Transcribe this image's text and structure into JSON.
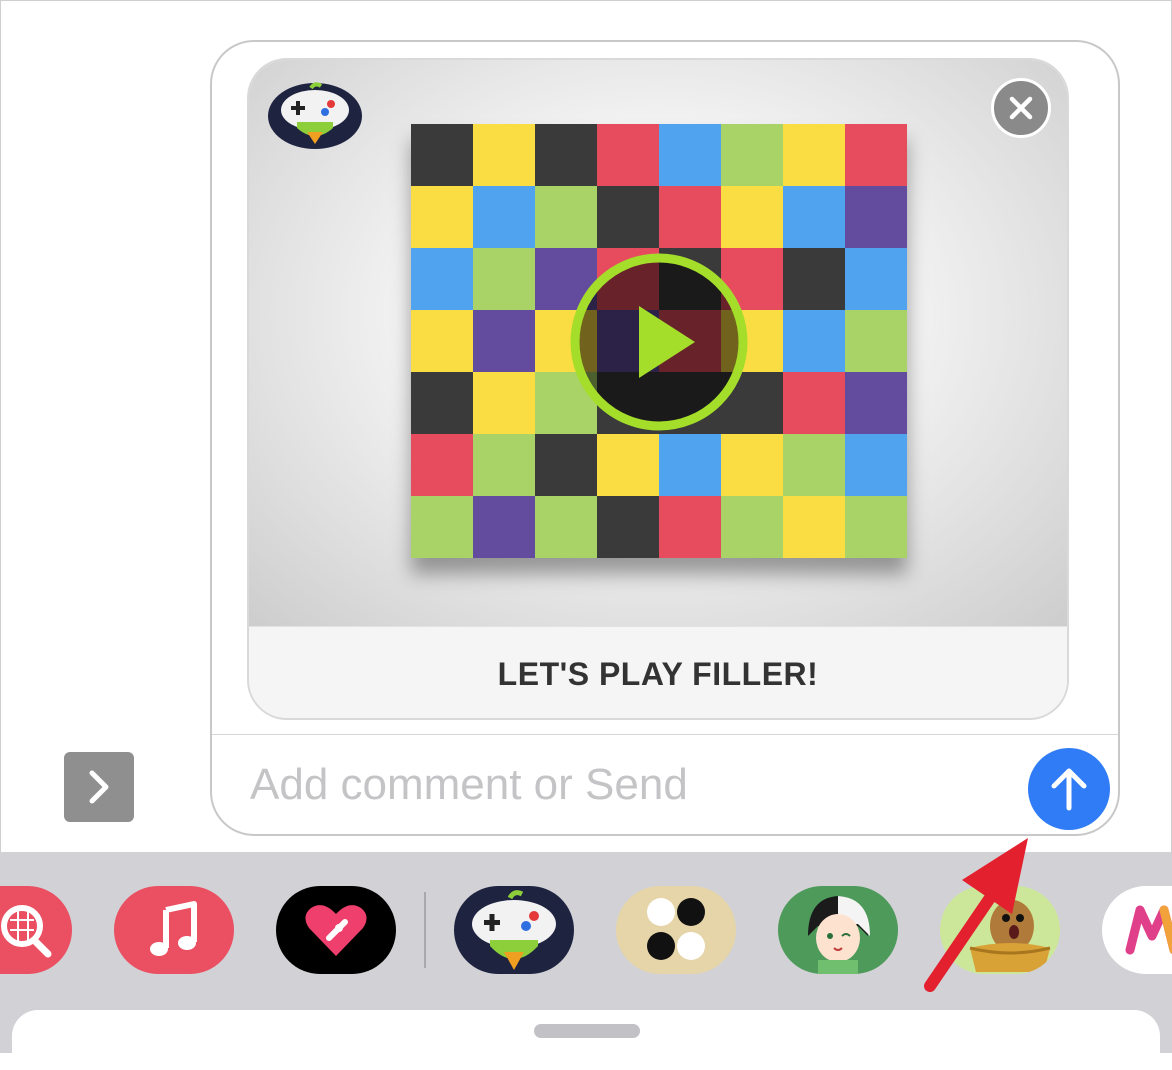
{
  "card": {
    "title": "LET'S PLAY FILLER!",
    "board_colors": [
      [
        "black",
        "yellow",
        "black",
        "red",
        "blue",
        "green",
        "yellow",
        "red"
      ],
      [
        "yellow",
        "blue",
        "green",
        "black",
        "red",
        "yellow",
        "blue",
        "purple"
      ],
      [
        "blue",
        "green",
        "purple",
        "red",
        "black",
        "red",
        "black",
        "blue"
      ],
      [
        "yellow",
        "purple",
        "yellow",
        "purple",
        "red",
        "yellow",
        "blue",
        "green"
      ],
      [
        "black",
        "yellow",
        "green",
        "black",
        "black",
        "black",
        "red",
        "purple"
      ],
      [
        "red",
        "green",
        "black",
        "yellow",
        "blue",
        "yellow",
        "green",
        "blue"
      ],
      [
        "green",
        "purple",
        "green",
        "black",
        "red",
        "green",
        "yellow",
        "green"
      ]
    ],
    "palette": {
      "black": "#3a3a3a",
      "yellow": "#fadc43",
      "red": "#e64c5e",
      "blue": "#50a3ee",
      "green": "#a9d366",
      "purple": "#634b9e"
    }
  },
  "compose": {
    "placeholder": "Add comment or Send"
  },
  "colors": {
    "send": "#2f7cf6",
    "play_ring": "#a5de2a",
    "annotation_arrow": "#e3202e"
  },
  "drawer": {
    "apps": [
      {
        "name": "search-images-icon"
      },
      {
        "name": "music-icon"
      },
      {
        "name": "digital-touch-icon"
      },
      {
        "name": "gamepigeon-icon"
      },
      {
        "name": "four-dots-game-icon"
      },
      {
        "name": "anime-avatar-icon"
      },
      {
        "name": "cartoon-character-icon"
      },
      {
        "name": "m-app-icon"
      }
    ]
  }
}
